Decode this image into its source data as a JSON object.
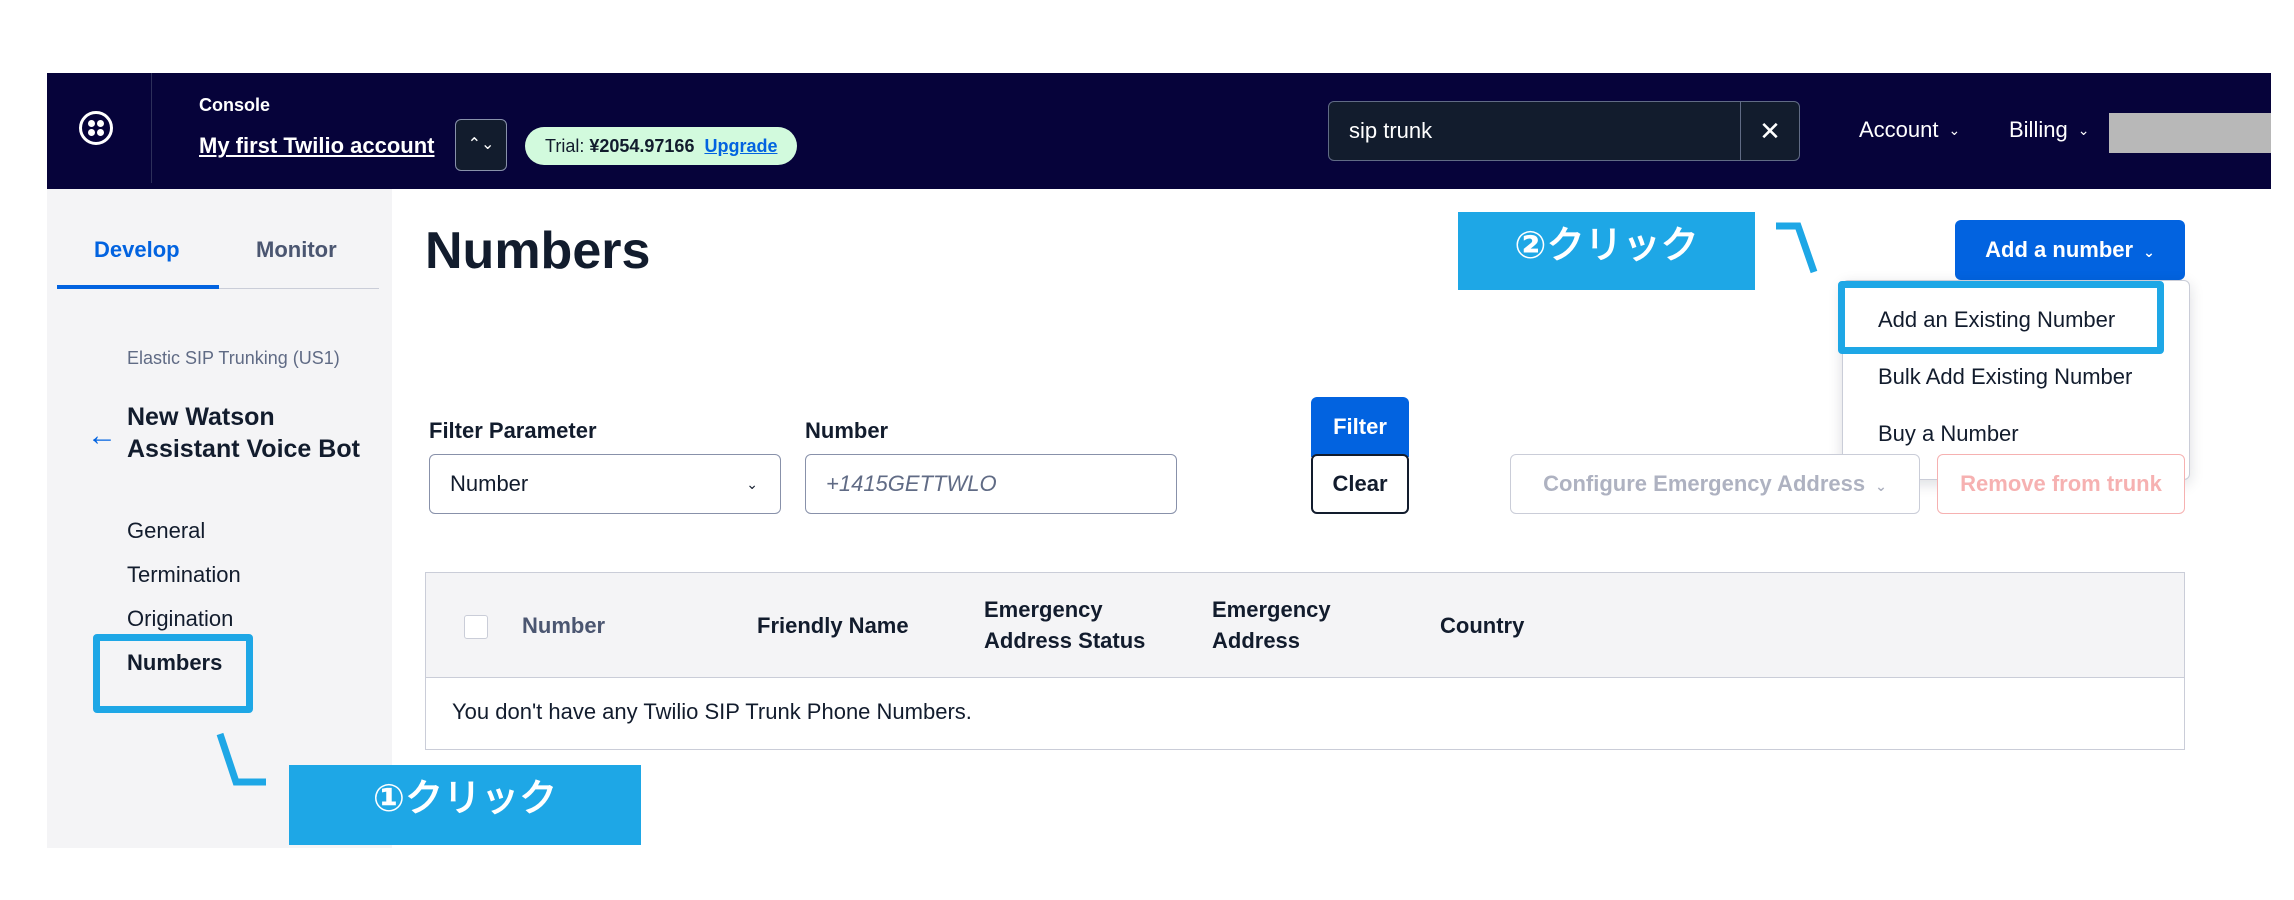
{
  "topbar": {
    "console_label": "Console",
    "account_name": "My first Twilio account",
    "account_switch_icon": "⌃⌄",
    "trial": {
      "label": "Trial: ",
      "amount": "¥2054.97166",
      "upgrade": "Upgrade"
    },
    "search": {
      "value": "sip trunk"
    },
    "search_clear_icon": "✕",
    "account_menu": "Account",
    "billing_menu": "Billing",
    "chevron": "⌄"
  },
  "sidebar": {
    "tabs": [
      {
        "label": "Develop"
      },
      {
        "label": "Monitor"
      }
    ],
    "product_label": "Elastic SIP Trunking (US1)",
    "back_icon": "←",
    "trunk_name": "New Watson Assistant Voice Bot",
    "nav": [
      {
        "label": "General"
      },
      {
        "label": "Termination"
      },
      {
        "label": "Origination"
      },
      {
        "label": "Numbers"
      }
    ]
  },
  "main": {
    "title": "Numbers",
    "add_number_button": "Add a number",
    "dropdown": [
      {
        "label": "Add an Existing Number"
      },
      {
        "label": "Bulk Add Existing Number"
      },
      {
        "label": "Buy a Number"
      }
    ],
    "filter": {
      "param_label": "Filter Parameter",
      "param_value": "Number",
      "number_label": "Number",
      "number_placeholder": "+1415GETTWLO",
      "filter_button": "Filter",
      "clear_button": "Clear"
    },
    "emergency_button": "Configure Emergency Address",
    "remove_button": "Remove from trunk",
    "table": {
      "columns": [
        {
          "label": "Number"
        },
        {
          "label": "Friendly Name"
        },
        {
          "label": "Emergency Address Status"
        },
        {
          "label": "Emergency Address"
        },
        {
          "label": "Country"
        }
      ],
      "empty_message": "You don't have any Twilio SIP Trunk Phone Numbers."
    }
  },
  "annotations": {
    "step1": "①クリック",
    "step2": "②クリック",
    "color": "#1ea7e6"
  },
  "colors": {
    "topbar_bg": "#06033a",
    "primary": "#0263e0",
    "sidebar_bg": "#f4f4f6",
    "trial_badge": "#d2fadd"
  }
}
